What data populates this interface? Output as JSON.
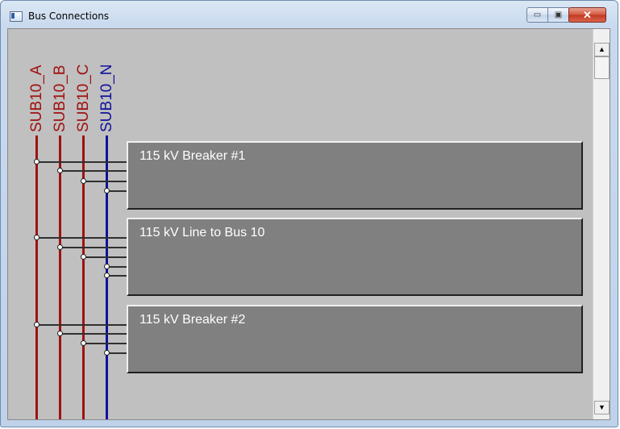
{
  "window": {
    "title": "Bus Connections",
    "controls": {
      "minimize": "▭",
      "maximize": "▣",
      "close": "✕"
    }
  },
  "buses": [
    {
      "label": "SUB10_A",
      "color": "#a01010"
    },
    {
      "label": "SUB10_B",
      "color": "#a01010"
    },
    {
      "label": "SUB10_C",
      "color": "#a01010"
    },
    {
      "label": "SUB10_N",
      "color": "#10109a"
    }
  ],
  "devices": [
    {
      "label": "115 kV Breaker #1"
    },
    {
      "label": "115 kV Line to Bus 10"
    },
    {
      "label": "115 kV Breaker #2"
    }
  ],
  "scrollbar": {
    "up_icon": "▲",
    "down_icon": "▼"
  }
}
